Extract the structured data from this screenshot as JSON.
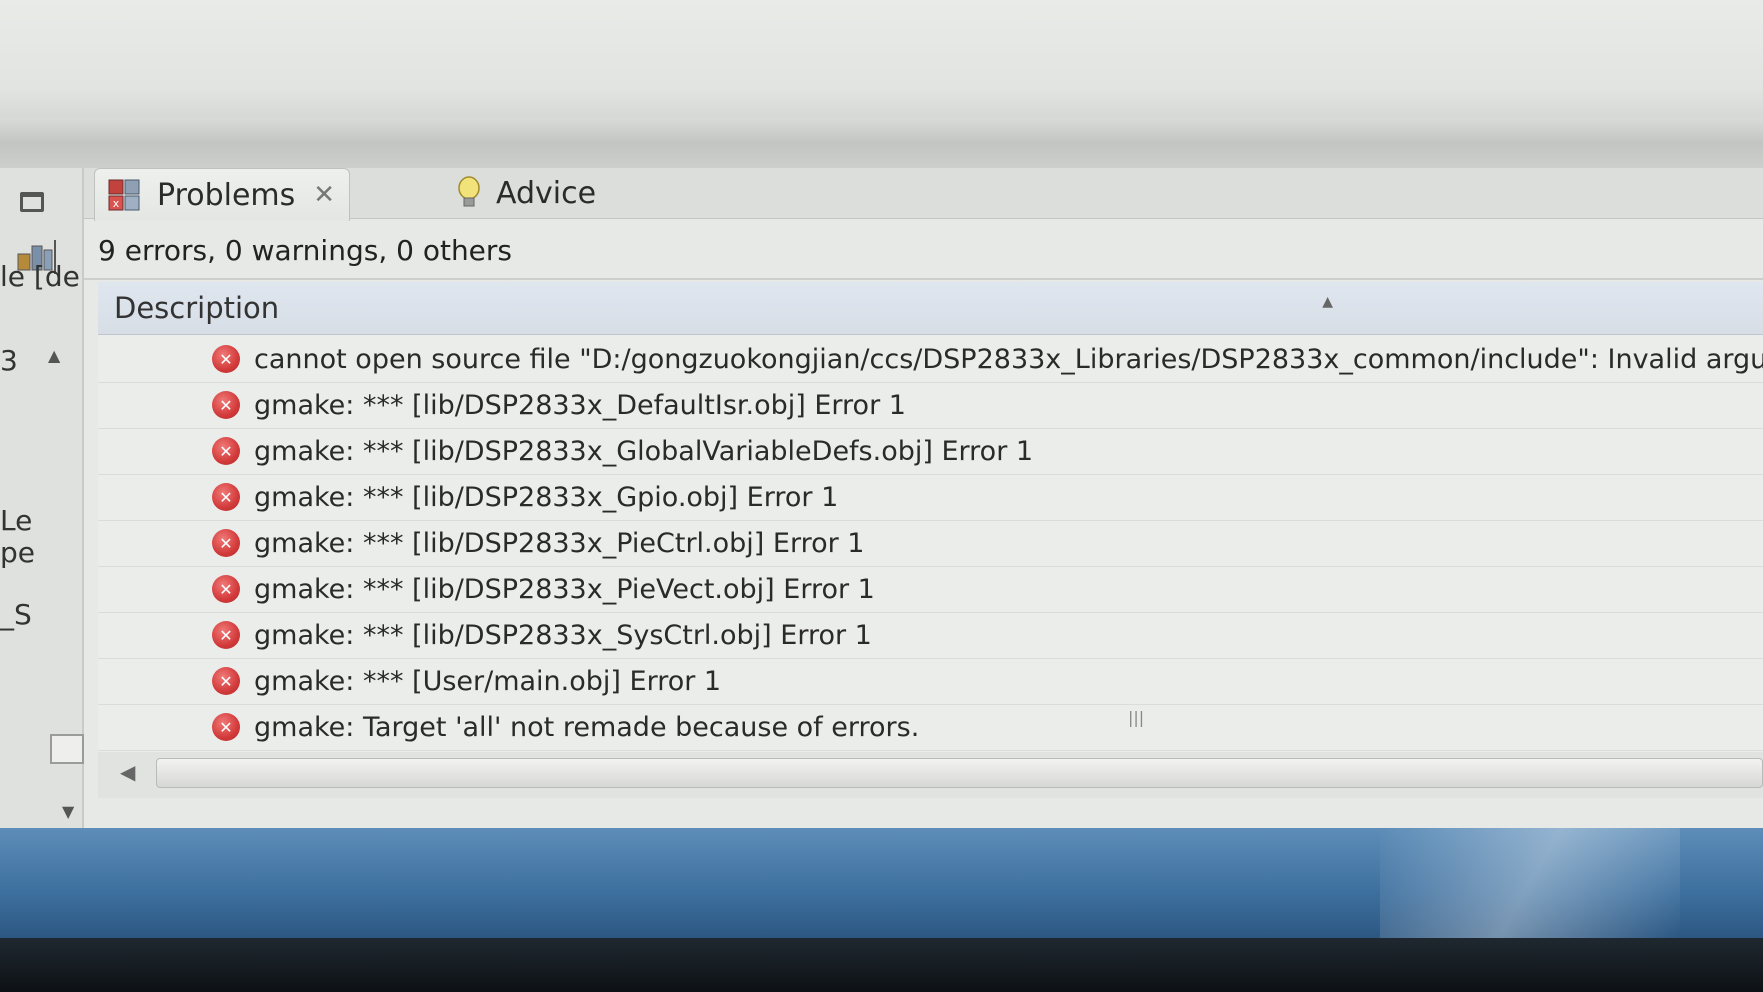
{
  "view": {
    "tabs": [
      {
        "label": "Problems",
        "active": true,
        "icon": "problems-icon"
      },
      {
        "label": "Advice",
        "active": false,
        "icon": "lightbulb-icon"
      }
    ],
    "summary": "9 errors, 0 warnings, 0 others",
    "columns": [
      "Description"
    ]
  },
  "left_panel": {
    "header_text": "le [de",
    "labels": [
      "3",
      "Le",
      "pe",
      "_S"
    ]
  },
  "problems": [
    {
      "severity": "error",
      "description": "cannot open source file \"D:/gongzuokongjian/ccs/DSP2833x_Libraries/DSP2833x_common/include\": Invalid argument null: cannot op"
    },
    {
      "severity": "error",
      "description": "gmake: *** [lib/DSP2833x_DefaultIsr.obj] Error 1"
    },
    {
      "severity": "error",
      "description": "gmake: *** [lib/DSP2833x_GlobalVariableDefs.obj] Error 1"
    },
    {
      "severity": "error",
      "description": "gmake: *** [lib/DSP2833x_Gpio.obj] Error 1"
    },
    {
      "severity": "error",
      "description": "gmake: *** [lib/DSP2833x_PieCtrl.obj] Error 1"
    },
    {
      "severity": "error",
      "description": "gmake: *** [lib/DSP2833x_PieVect.obj] Error 1"
    },
    {
      "severity": "error",
      "description": "gmake: *** [lib/DSP2833x_SysCtrl.obj] Error 1"
    },
    {
      "severity": "error",
      "description": "gmake: *** [User/main.obj] Error 1"
    },
    {
      "severity": "error",
      "description": "gmake: Target 'all' not remade because of errors."
    }
  ],
  "colors": {
    "error": "#d23a3a",
    "header_bg": "#dfe6ef",
    "taskbar": "#3d6f9e"
  }
}
